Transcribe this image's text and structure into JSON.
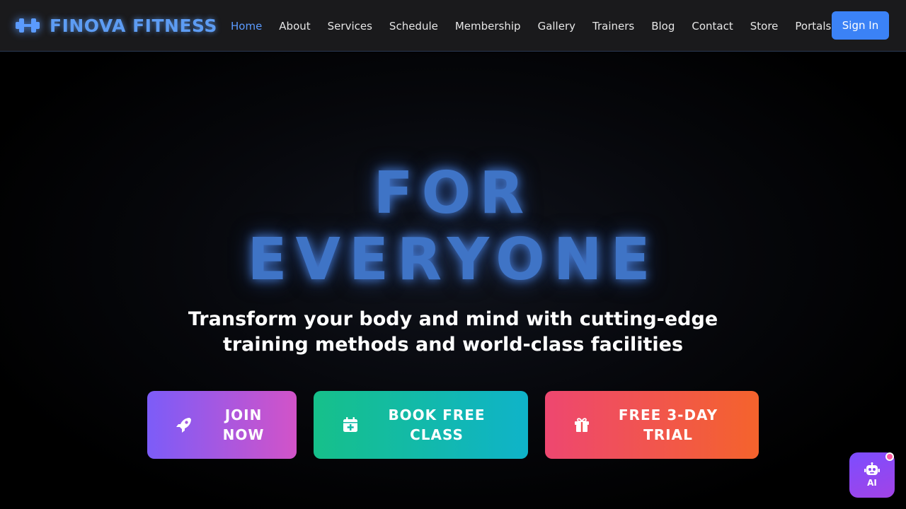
{
  "brand": {
    "name": "FINOVA FITNESS",
    "icon": "dumbbell-icon"
  },
  "nav": {
    "items": [
      {
        "label": "Home",
        "active": true
      },
      {
        "label": "About"
      },
      {
        "label": "Services"
      },
      {
        "label": "Schedule"
      },
      {
        "label": "Membership"
      },
      {
        "label": "Gallery"
      },
      {
        "label": "Trainers"
      },
      {
        "label": "Blog"
      },
      {
        "label": "Contact"
      },
      {
        "label": "Store"
      },
      {
        "label": "Portals",
        "dropdown": true,
        "icon": "chevron-down-icon"
      }
    ],
    "signin_label": "Sign In"
  },
  "hero": {
    "title_line1": "FOR",
    "title_line2": "EVERYONE",
    "subtitle": "Transform your body and mind with cutting-edge training methods and world-class facilities"
  },
  "cta": {
    "join": {
      "label": "JOIN NOW",
      "icon": "rocket-icon"
    },
    "book": {
      "label": "BOOK FREE CLASS",
      "icon": "calendar-plus-icon"
    },
    "trial": {
      "label": "FREE 3-DAY TRIAL",
      "icon": "gift-icon"
    }
  },
  "ai_assistant": {
    "label": "AI",
    "icon": "robot-icon"
  },
  "colors": {
    "accent": "#3b82f6",
    "brand": "#5d9cf3",
    "hero_title": "#3f74c6",
    "join_gradient": [
      "#7c5cf8",
      "#d253c8"
    ],
    "book_gradient": [
      "#16c08a",
      "#0fb3c9"
    ],
    "trial_gradient": [
      "#ee4770",
      "#f4632c"
    ],
    "ai_gradient": [
      "#7c4dff",
      "#a243e6"
    ]
  }
}
